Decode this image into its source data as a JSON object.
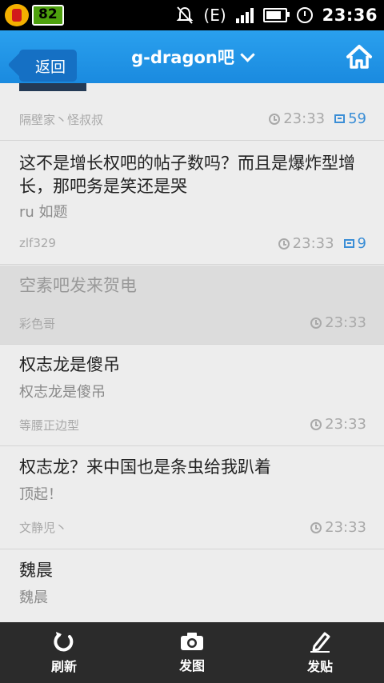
{
  "status_bar": {
    "battery_level": "82",
    "time": "23:36",
    "network_label": "E"
  },
  "header": {
    "back_label": "返回",
    "title": "g-dragon吧"
  },
  "posts": [
    {
      "title": "",
      "excerpt": "",
      "author": "隔壁家丶怪叔叔",
      "time": "23:33",
      "replies": "59"
    },
    {
      "title": "这不是增长权吧的帖子数吗？而且是爆炸型增长，那吧务是笑还是哭",
      "excerpt": "ru 如题",
      "author": "zlf329",
      "time": "23:33",
      "replies": "9"
    },
    {
      "title": "空素吧发来贺电",
      "excerpt": "",
      "author": "彩色哥",
      "time": "23:33",
      "replies": ""
    },
    {
      "title": "权志龙是傻吊",
      "excerpt": "权志龙是傻吊",
      "author": "等腰正边型",
      "time": "23:33",
      "replies": ""
    },
    {
      "title": "权志龙？来中国也是条虫给我趴着",
      "excerpt": "顶起！",
      "author": "文静児丶",
      "time": "23:33",
      "replies": ""
    },
    {
      "title": "魏晨",
      "excerpt": "魏晨",
      "author": "",
      "time": "",
      "replies": ""
    }
  ],
  "bottom_bar": {
    "refresh_label": "刷新",
    "photo_label": "发图",
    "post_label": "发贴"
  },
  "colors": {
    "header_blue": "#1a8adf",
    "reply_blue": "#3b8ed6",
    "bottom_bar": "#2b2b2b"
  }
}
